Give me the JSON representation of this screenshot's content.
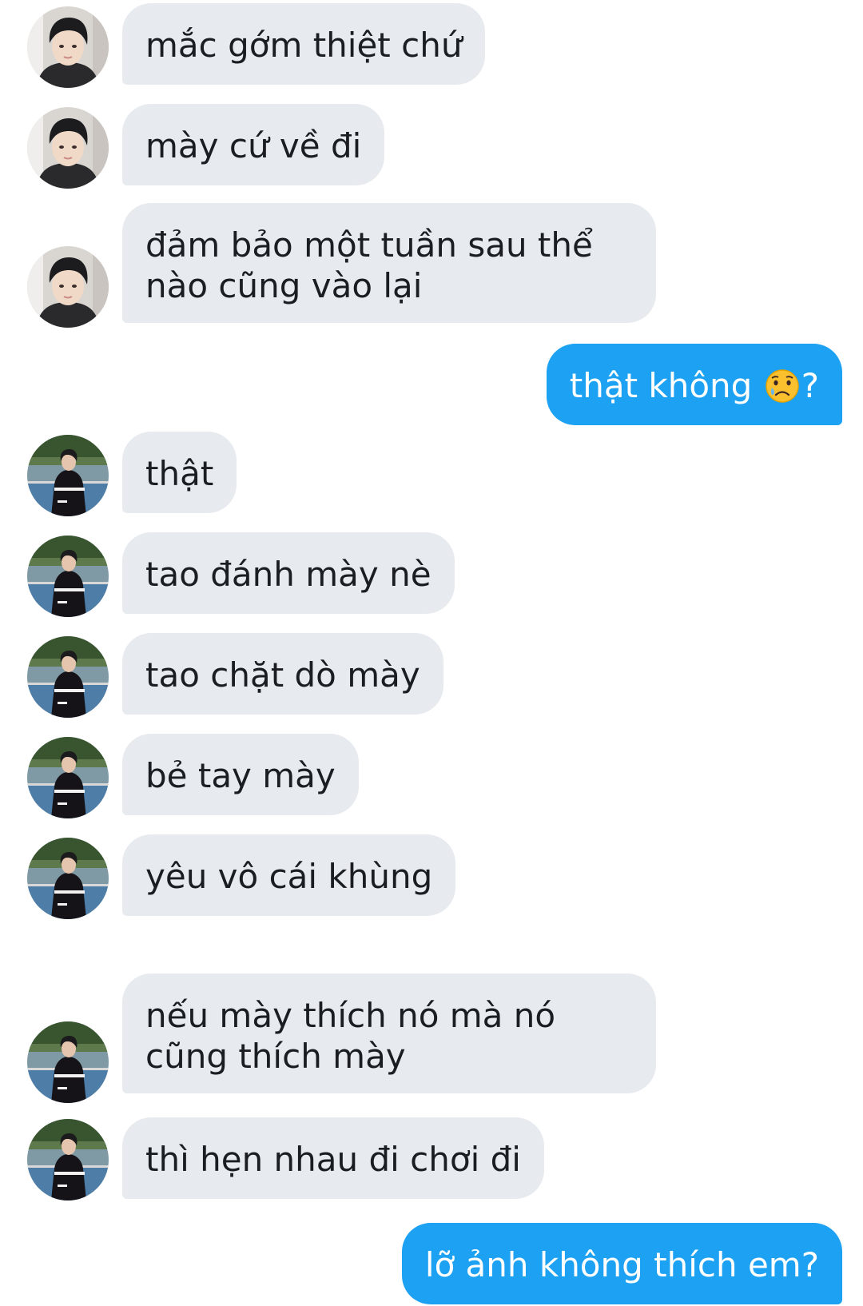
{
  "thread": {
    "messages": [
      {
        "side": "in",
        "avatar": "avatar-a",
        "text": "mắc gớm thiệt chứ"
      },
      {
        "side": "in",
        "avatar": "avatar-a",
        "text": "mày cứ về đi"
      },
      {
        "side": "in",
        "avatar": "avatar-a",
        "text": "đảm bảo một tuần sau thể nào cũng vào lại"
      },
      {
        "side": "out",
        "text_before": "thật không",
        "emoji": "crying-face-emoji",
        "text_after": "?"
      },
      {
        "side": "in",
        "avatar": "avatar-b",
        "text": "thật"
      },
      {
        "side": "in",
        "avatar": "avatar-b",
        "text": "tao đánh mày nè"
      },
      {
        "side": "in",
        "avatar": "avatar-b",
        "text": "tao chặt dò mày"
      },
      {
        "side": "in",
        "avatar": "avatar-b",
        "text": "bẻ tay mày"
      },
      {
        "side": "in",
        "avatar": "avatar-b",
        "text": "yêu vô cái khùng"
      },
      {
        "side": "in",
        "avatar": "avatar-b",
        "text": "nếu mày thích nó mà nó cũng thích mày"
      },
      {
        "side": "in",
        "avatar": "avatar-b",
        "text": "thì hẹn nhau đi chơi đi"
      },
      {
        "side": "out",
        "text": "lỡ ảnh không thích em?"
      }
    ]
  },
  "colors": {
    "incoming_bubble": "#e7eaee",
    "outgoing_bubble": "#1da1f2",
    "incoming_text": "#1a1d21",
    "outgoing_text": "#ffffff"
  }
}
